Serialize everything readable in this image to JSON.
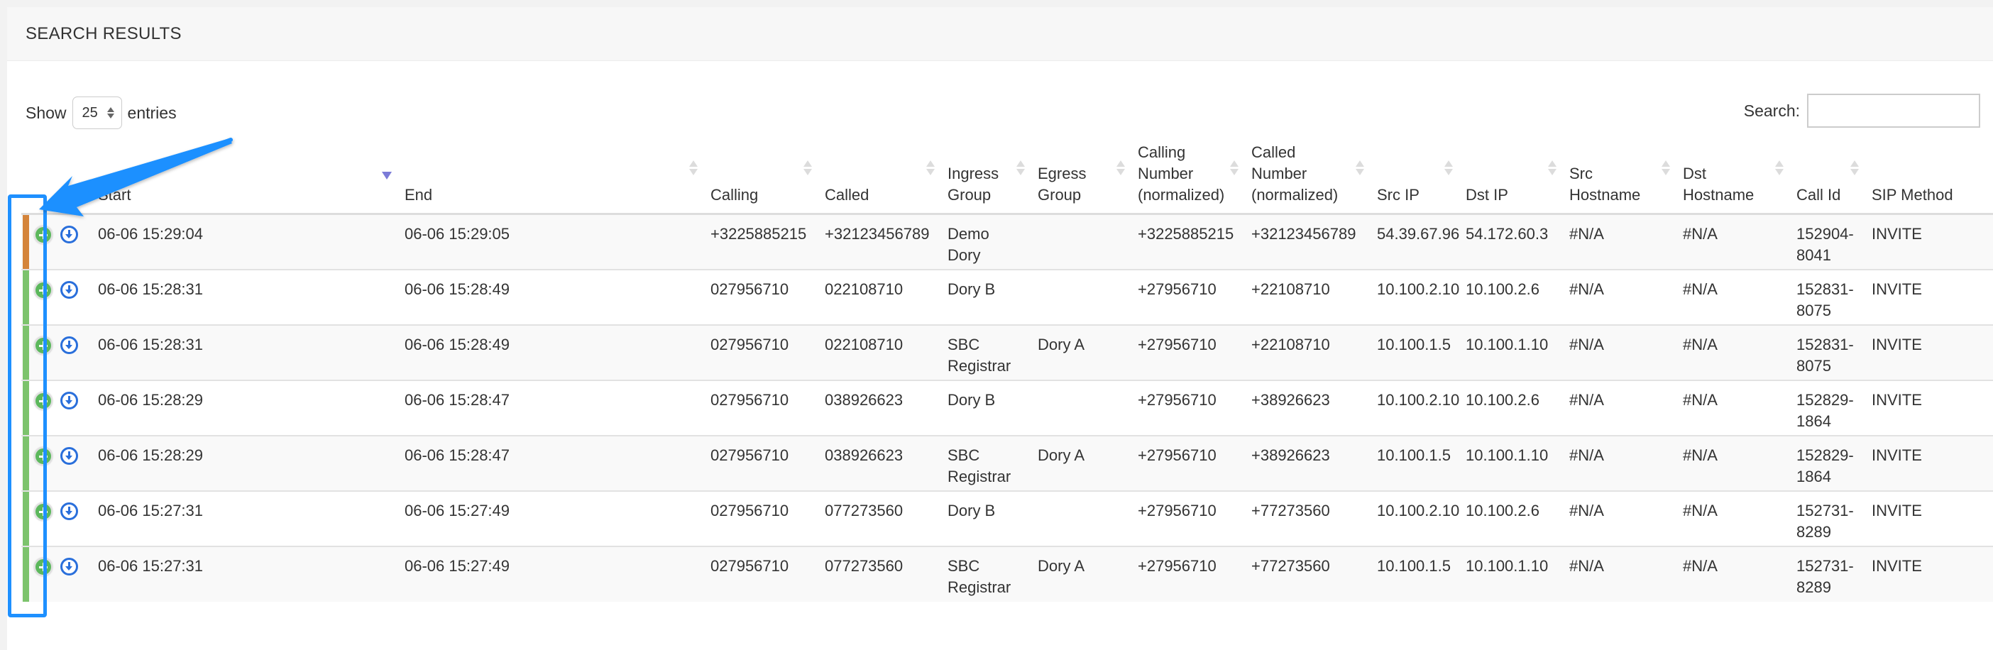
{
  "panel": {
    "title": "SEARCH RESULTS"
  },
  "length_control": {
    "prefix": "Show",
    "value": "25",
    "suffix": "entries"
  },
  "search": {
    "label": "Search:",
    "value": "",
    "placeholder": ""
  },
  "table": {
    "sorted_column": "Start",
    "sort_direction": "descending",
    "columns": [
      {
        "key": "ctrl",
        "label": ""
      },
      {
        "key": "start",
        "label": "Start"
      },
      {
        "key": "end",
        "label": "End"
      },
      {
        "key": "calling",
        "label": "Calling"
      },
      {
        "key": "called",
        "label": "Called"
      },
      {
        "key": "ingress_group",
        "label": "Ingress Group"
      },
      {
        "key": "egress_group",
        "label": "Egress Group"
      },
      {
        "key": "calling_normalized",
        "label": "Calling Number (normalized)"
      },
      {
        "key": "called_normalized",
        "label": "Called Number (normalized)"
      },
      {
        "key": "src_ip",
        "label": "Src IP"
      },
      {
        "key": "dst_ip",
        "label": "Dst IP"
      },
      {
        "key": "src_hostname",
        "label": "Src Hostname"
      },
      {
        "key": "dst_hostname",
        "label": "Dst Hostname"
      },
      {
        "key": "call_id",
        "label": "Call Id"
      },
      {
        "key": "sip_method",
        "label": "SIP Method"
      }
    ],
    "rows": [
      {
        "status_color": "#d4843a",
        "expand_icon": "plus-circle-icon",
        "download_icon": "download-circle-icon",
        "start": "06-06 15:29:04",
        "end": "06-06 15:29:05",
        "calling": "+3225885215",
        "called": "+32123456789",
        "ingress_group": "Demo Dory",
        "egress_group": "",
        "calling_normalized": "+3225885215",
        "called_normalized": "+32123456789",
        "src_ip": "54.39.67.96",
        "dst_ip": "54.172.60.3",
        "src_hostname": "#N/A",
        "dst_hostname": "#N/A",
        "call_id": "152904-8041",
        "sip_method": "INVITE"
      },
      {
        "status_color": "#7cc36c",
        "expand_icon": "plus-circle-icon",
        "download_icon": "download-circle-icon",
        "start": "06-06 15:28:31",
        "end": "06-06 15:28:49",
        "calling": "027956710",
        "called": "022108710",
        "ingress_group": "Dory B",
        "egress_group": "",
        "calling_normalized": "+27956710",
        "called_normalized": "+22108710",
        "src_ip": "10.100.2.10",
        "dst_ip": "10.100.2.6",
        "src_hostname": "#N/A",
        "dst_hostname": "#N/A",
        "call_id": "152831-8075",
        "sip_method": "INVITE"
      },
      {
        "status_color": "#7cc36c",
        "expand_icon": "plus-circle-icon",
        "download_icon": "download-circle-icon",
        "start": "06-06 15:28:31",
        "end": "06-06 15:28:49",
        "calling": "027956710",
        "called": "022108710",
        "ingress_group": "SBC Registrar",
        "egress_group": "Dory A",
        "calling_normalized": "+27956710",
        "called_normalized": "+22108710",
        "src_ip": "10.100.1.5",
        "dst_ip": "10.100.1.10",
        "src_hostname": "#N/A",
        "dst_hostname": "#N/A",
        "call_id": "152831-8075",
        "sip_method": "INVITE"
      },
      {
        "status_color": "#7cc36c",
        "expand_icon": "plus-circle-icon",
        "download_icon": "download-circle-icon",
        "start": "06-06 15:28:29",
        "end": "06-06 15:28:47",
        "calling": "027956710",
        "called": "038926623",
        "ingress_group": "Dory B",
        "egress_group": "",
        "calling_normalized": "+27956710",
        "called_normalized": "+38926623",
        "src_ip": "10.100.2.10",
        "dst_ip": "10.100.2.6",
        "src_hostname": "#N/A",
        "dst_hostname": "#N/A",
        "call_id": "152829-1864",
        "sip_method": "INVITE"
      },
      {
        "status_color": "#7cc36c",
        "expand_icon": "plus-circle-icon",
        "download_icon": "download-circle-icon",
        "start": "06-06 15:28:29",
        "end": "06-06 15:28:47",
        "calling": "027956710",
        "called": "038926623",
        "ingress_group": "SBC Registrar",
        "egress_group": "Dory A",
        "calling_normalized": "+27956710",
        "called_normalized": "+38926623",
        "src_ip": "10.100.1.5",
        "dst_ip": "10.100.1.10",
        "src_hostname": "#N/A",
        "dst_hostname": "#N/A",
        "call_id": "152829-1864",
        "sip_method": "INVITE"
      },
      {
        "status_color": "#7cc36c",
        "expand_icon": "plus-circle-icon",
        "download_icon": "download-circle-icon",
        "start": "06-06 15:27:31",
        "end": "06-06 15:27:49",
        "calling": "027956710",
        "called": "077273560",
        "ingress_group": "Dory B",
        "egress_group": "",
        "calling_normalized": "+27956710",
        "called_normalized": "+77273560",
        "src_ip": "10.100.2.10",
        "dst_ip": "10.100.2.6",
        "src_hostname": "#N/A",
        "dst_hostname": "#N/A",
        "call_id": "152731-8289",
        "sip_method": "INVITE"
      },
      {
        "status_color": "#7cc36c",
        "expand_icon": "plus-circle-icon",
        "download_icon": "download-circle-icon",
        "start": "06-06 15:27:31",
        "end": "06-06 15:27:49",
        "calling": "027956710",
        "called": "077273560",
        "ingress_group": "SBC Registrar",
        "egress_group": "Dory A",
        "calling_normalized": "+27956710",
        "called_normalized": "+77273560",
        "src_ip": "10.100.1.5",
        "dst_ip": "10.100.1.10",
        "src_hostname": "#N/A",
        "dst_hostname": "#N/A",
        "call_id": "152731-8289",
        "sip_method": "INVITE"
      }
    ]
  },
  "annotation": {
    "color": "#1e90ff",
    "type": "arrow-and-highlight-box",
    "target": "row status bars and expand icons"
  },
  "colors": {
    "status_warning": "#d4843a",
    "status_ok": "#7cc36c",
    "sort_active": "#7b7bd8",
    "download_blue": "#2a6fdb",
    "expand_green": "#5cb85c"
  }
}
